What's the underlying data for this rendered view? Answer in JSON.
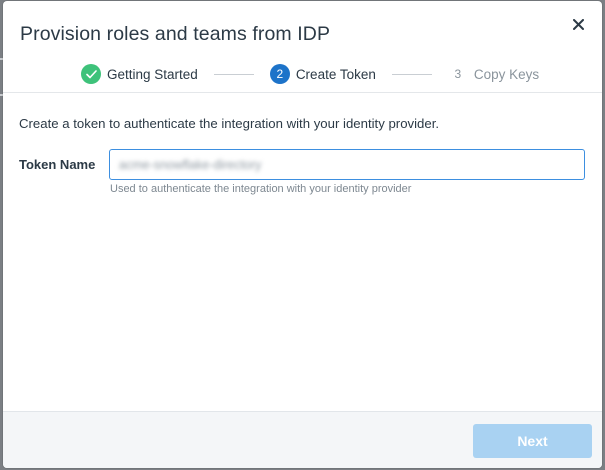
{
  "dialog": {
    "title": "Provision roles and teams from IDP",
    "close_icon": "close-icon"
  },
  "stepper": {
    "steps": [
      {
        "number": "",
        "label": "Getting Started",
        "state": "done",
        "icon": "check-icon"
      },
      {
        "number": "2",
        "label": "Create Token",
        "state": "active"
      },
      {
        "number": "3",
        "label": "Copy Keys",
        "state": "pending"
      }
    ]
  },
  "body": {
    "intro": "Create a token to authenticate the integration with your identity provider.",
    "token_field": {
      "label": "Token Name",
      "value": "acme-snowflake-directory",
      "helper": "Used to authenticate the integration with your identity provider"
    }
  },
  "footer": {
    "next_label": "Next",
    "next_enabled": false
  },
  "colors": {
    "done": "#3ec27a",
    "active": "#1d73c9",
    "button_disabled": "#a9d2f2",
    "input_focus": "#3d8fe0"
  }
}
